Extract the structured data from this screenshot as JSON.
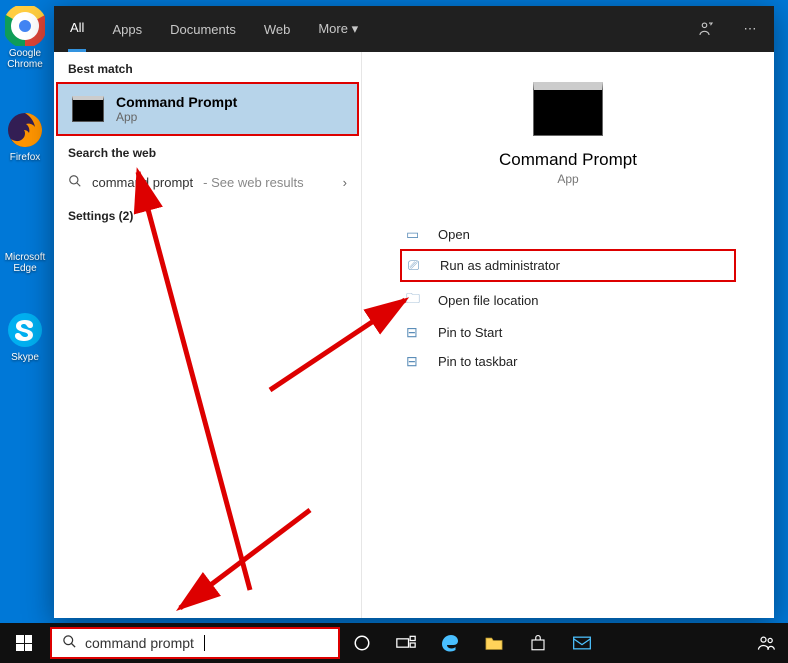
{
  "desktop": {
    "chrome": "Google Chrome",
    "firefox": "Firefox",
    "edge": "Microsoft Edge",
    "skype": "Skype"
  },
  "header": {
    "tabs": {
      "all": "All",
      "apps": "Apps",
      "documents": "Documents",
      "web": "Web",
      "more": "More ▾"
    }
  },
  "results": {
    "best_match_label": "Best match",
    "best_match": {
      "title": "Command Prompt",
      "subtitle": "App"
    },
    "search_web_label": "Search the web",
    "web_query": "command prompt",
    "web_hint": " - See web results",
    "settings_label": "Settings (2)"
  },
  "detail": {
    "title": "Command Prompt",
    "subtitle": "App",
    "actions": {
      "open": "Open",
      "run_admin": "Run as administrator",
      "open_loc": "Open file location",
      "pin_start": "Pin to Start",
      "pin_taskbar": "Pin to taskbar"
    }
  },
  "taskbar": {
    "search_value": "command prompt"
  }
}
